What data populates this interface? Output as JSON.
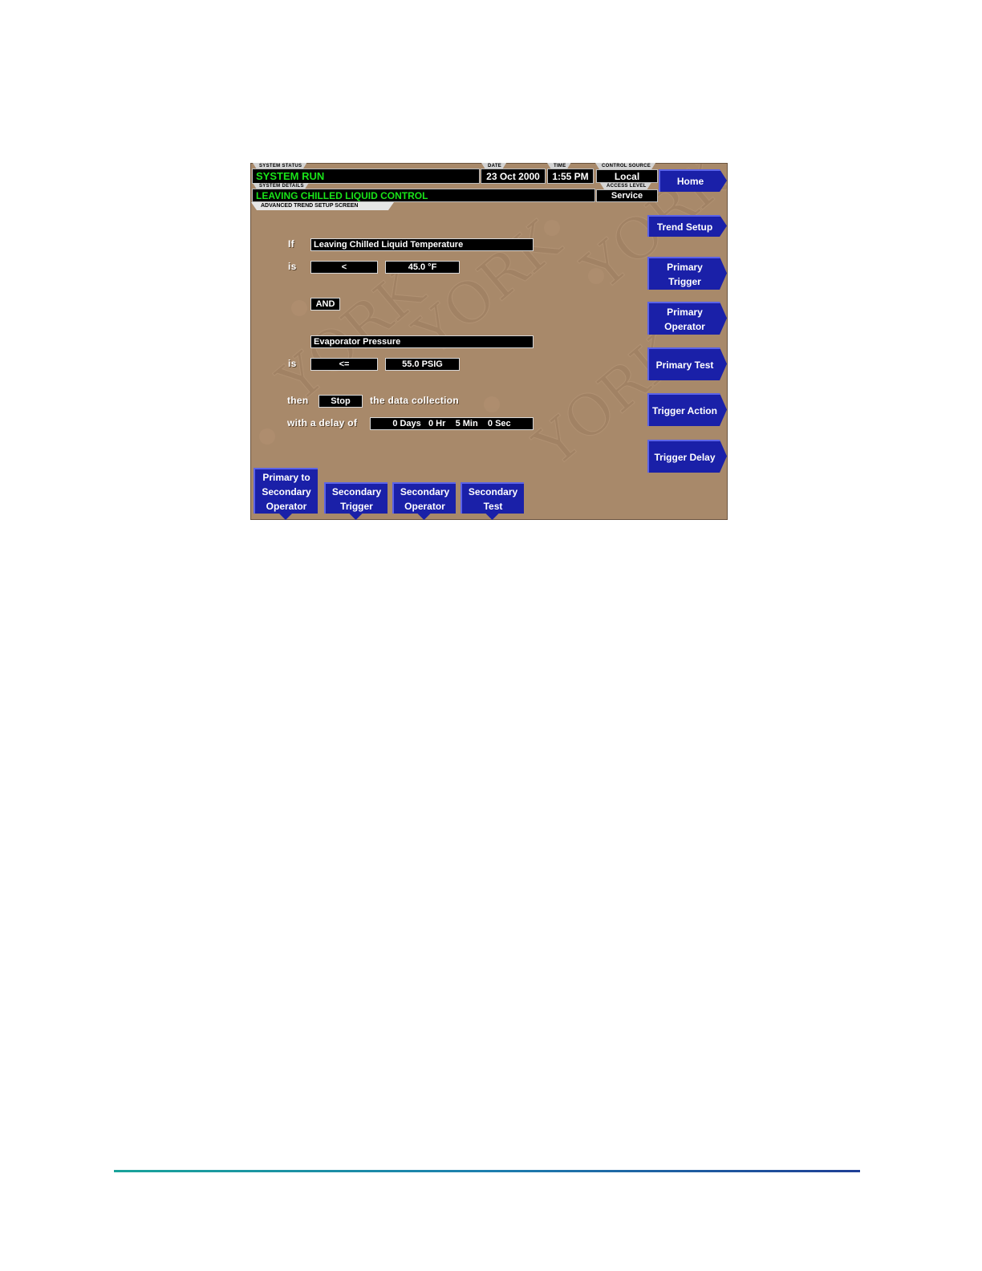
{
  "header": {
    "system_status_label": "SYSTEM STATUS",
    "system_status": "SYSTEM RUN",
    "system_details_label": "SYSTEM DETAILS",
    "system_details": "LEAVING CHILLED LIQUID CONTROL",
    "date_label": "DATE",
    "date": "23 Oct 2000",
    "time_label": "TIME",
    "time": "1:55 PM",
    "control_source_label": "CONTROL SOURCE",
    "control_source": "Local",
    "access_level_label": "ACCESS LEVEL",
    "access_level": "Service",
    "screen_title": "ADVANCED TREND SETUP SCREEN"
  },
  "form": {
    "if_label": "If",
    "primary_trigger": "Leaving Chilled Liquid Temperature",
    "is_label_1": "is",
    "primary_operator": "<",
    "primary_value": "45.0 °F",
    "combine_operator": "AND",
    "secondary_trigger": "Evaporator Pressure",
    "is_label_2": "is",
    "secondary_operator": "<=",
    "secondary_value": "55.0 PSIG",
    "then_label": "then",
    "action": "Stop",
    "action_suffix": "the data collection",
    "delay_label": "with a delay of",
    "delay": "0 Days   0 Hr    5 Min    0 Sec"
  },
  "right_buttons": {
    "home": "Home",
    "trend_setup": "Trend Setup",
    "primary_trigger_1": "Primary",
    "primary_trigger_2": "Trigger",
    "primary_operator_1": "Primary",
    "primary_operator_2": "Operator",
    "primary_test": "Primary Test",
    "trigger_action": "Trigger Action",
    "trigger_delay": "Trigger Delay"
  },
  "bottom_buttons": {
    "p2s_1": "Primary to",
    "p2s_2": "Secondary",
    "p2s_3": "Operator",
    "sec_trigger_1": "Secondary",
    "sec_trigger_2": "Trigger",
    "sec_operator_1": "Secondary",
    "sec_operator_2": "Operator",
    "sec_test_1": "Secondary",
    "sec_test_2": "Test"
  },
  "colors": {
    "panel_bg": "#a8896a",
    "button_blue": "#1a20a8",
    "status_green": "#19e319",
    "footer_line_start": "#1aa39a",
    "footer_line_end": "#1f3f95"
  }
}
